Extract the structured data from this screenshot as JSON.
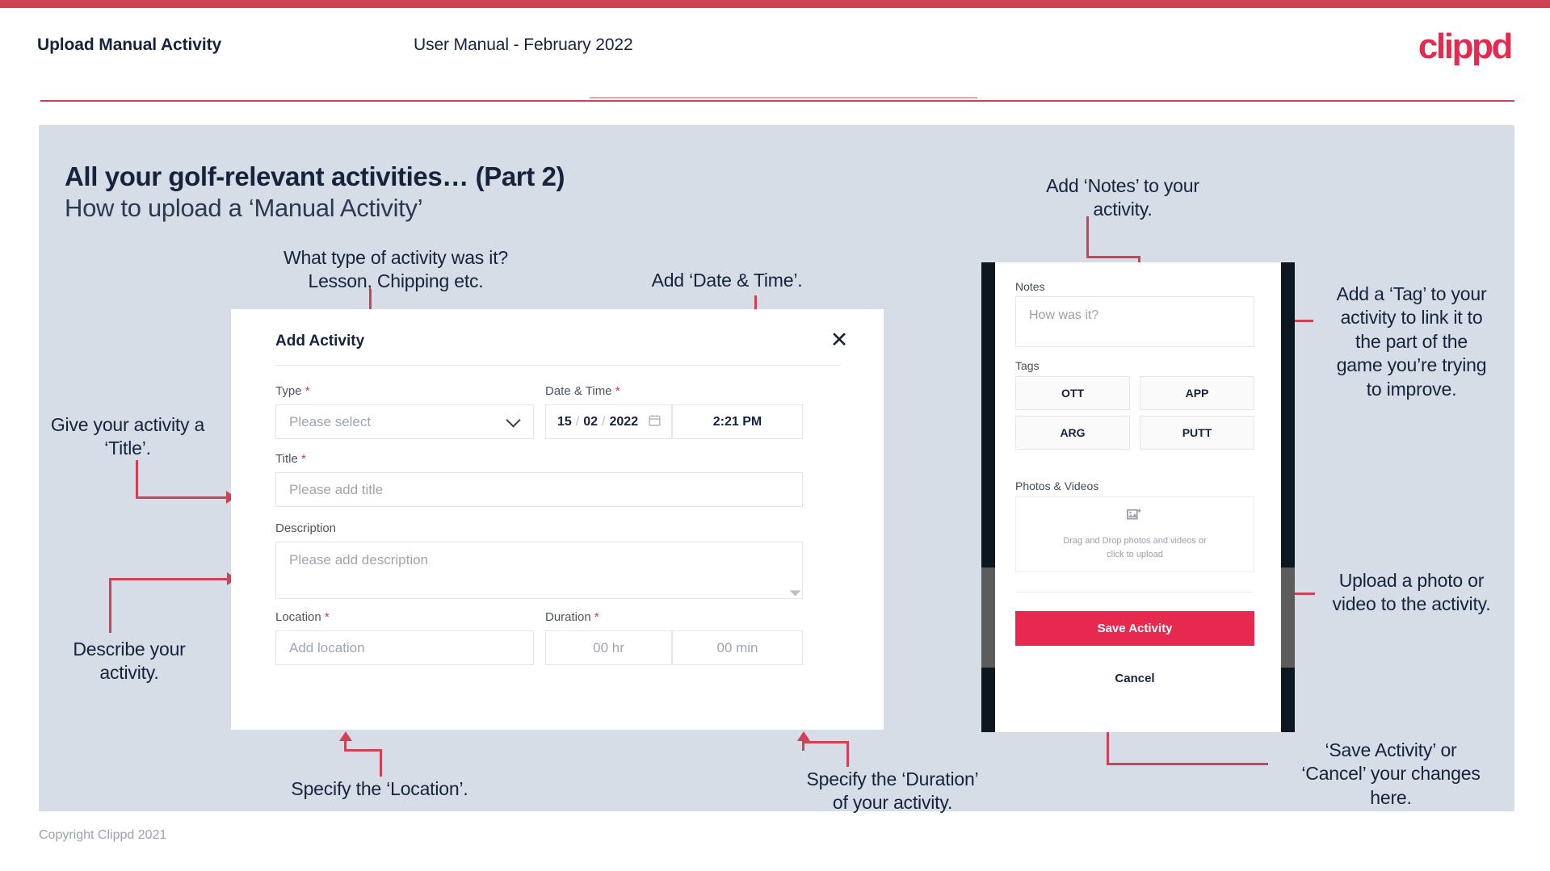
{
  "header": {
    "title": "Upload Manual Activity",
    "subtitle": "User Manual - February 2022",
    "logo": "clippd"
  },
  "slide": {
    "heading": "All your golf-relevant activities… (Part 2)",
    "subheading": "How to upload a ‘Manual Activity’",
    "copyright": "Copyright Clippd 2021"
  },
  "annotations": {
    "type": "What type of activity was it?\nLesson, Chipping etc.",
    "date_time": "Add ‘Date & Time’.",
    "title": "Give your activity a\n‘Title’.",
    "description": "Describe your\nactivity.",
    "location": "Specify the ‘Location’.",
    "duration": "Specify the ‘Duration’\nof your activity.",
    "notes": "Add ‘Notes’ to your\nactivity.",
    "tags": "Add a ‘Tag’ to your\nactivity to link it to\nthe part of the\ngame you’re trying\nto improve.",
    "photos": "Upload a photo or\nvideo to the activity.",
    "save_cancel": "‘Save Activity’ or\n‘Cancel’ your changes\nhere."
  },
  "dialog": {
    "title": "Add Activity",
    "close_icon": "close-icon",
    "fields": {
      "type": {
        "label": "Type",
        "required": "*",
        "placeholder": "Please select"
      },
      "date_time": {
        "label": "Date & Time",
        "required": "*",
        "day": "15",
        "sep1": "/",
        "month": "02",
        "sep2": "/",
        "year": "2022",
        "calendar_icon": "calendar-icon",
        "time": "2:21 PM"
      },
      "title": {
        "label": "Title",
        "required": "*",
        "placeholder": "Please add title"
      },
      "description": {
        "label": "Description",
        "required": "",
        "placeholder": "Please add description"
      },
      "location": {
        "label": "Location",
        "required": "*",
        "placeholder": "Add location"
      },
      "duration": {
        "label": "Duration",
        "required": "*",
        "hours": "00 hr",
        "minutes": "00 min"
      }
    }
  },
  "mobile": {
    "notes": {
      "label": "Notes",
      "placeholder": "How was it?"
    },
    "tags": {
      "label": "Tags",
      "options": [
        "OTT",
        "APP",
        "ARG",
        "PUTT"
      ]
    },
    "photos": {
      "label": "Photos & Videos",
      "icon": "add-image-icon",
      "hint_line1": "Drag and Drop photos and videos or",
      "hint_line2": "click to upload"
    },
    "save_label": "Save Activity",
    "cancel_label": "Cancel"
  },
  "colors": {
    "accent": "#e8294f",
    "strip": "#cf4256",
    "slide_bg": "#d7dde6",
    "text_dark": "#15233c"
  }
}
